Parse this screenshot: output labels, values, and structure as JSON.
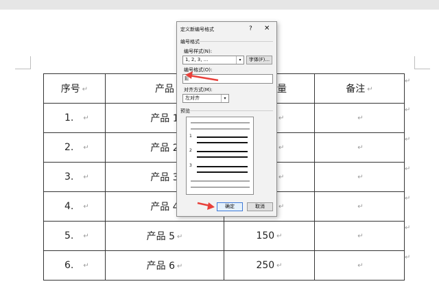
{
  "table": {
    "header": {
      "seq": "序号",
      "product": "产品",
      "col3": "量",
      "remark": "备注"
    },
    "rows": [
      {
        "seq": "1.",
        "product": "产品 1",
        "qty": "",
        "remark": ""
      },
      {
        "seq": "2.",
        "product": "产品 2",
        "qty": "",
        "remark": ""
      },
      {
        "seq": "3.",
        "product": "产品 3",
        "qty": "",
        "remark": ""
      },
      {
        "seq": "4.",
        "product": "产品 4",
        "qty": "",
        "remark": ""
      },
      {
        "seq": "5.",
        "product": "产品 5",
        "qty": "150",
        "remark": ""
      },
      {
        "seq": "6.",
        "product": "产品 6",
        "qty": "250",
        "remark": ""
      }
    ],
    "para_mark": "↵"
  },
  "dialog": {
    "title": "定义新编号格式",
    "help": "?",
    "close": "✕",
    "section_label": "编号格式",
    "style_label": "编号样式(N):",
    "style_value": "1, 2, 3, ...",
    "font_button": "字体(F)...",
    "format_label": "编号格式(O):",
    "format_value": "1.",
    "align_label": "对齐方式(M):",
    "align_value": "左对齐",
    "preview_label": "预览",
    "preview_numbers": [
      "1",
      "2",
      "3"
    ],
    "ok_button": "确定",
    "cancel_button": "取消"
  },
  "colors": {
    "arrow": "#e8403a",
    "ok_border": "#3c78d8"
  }
}
